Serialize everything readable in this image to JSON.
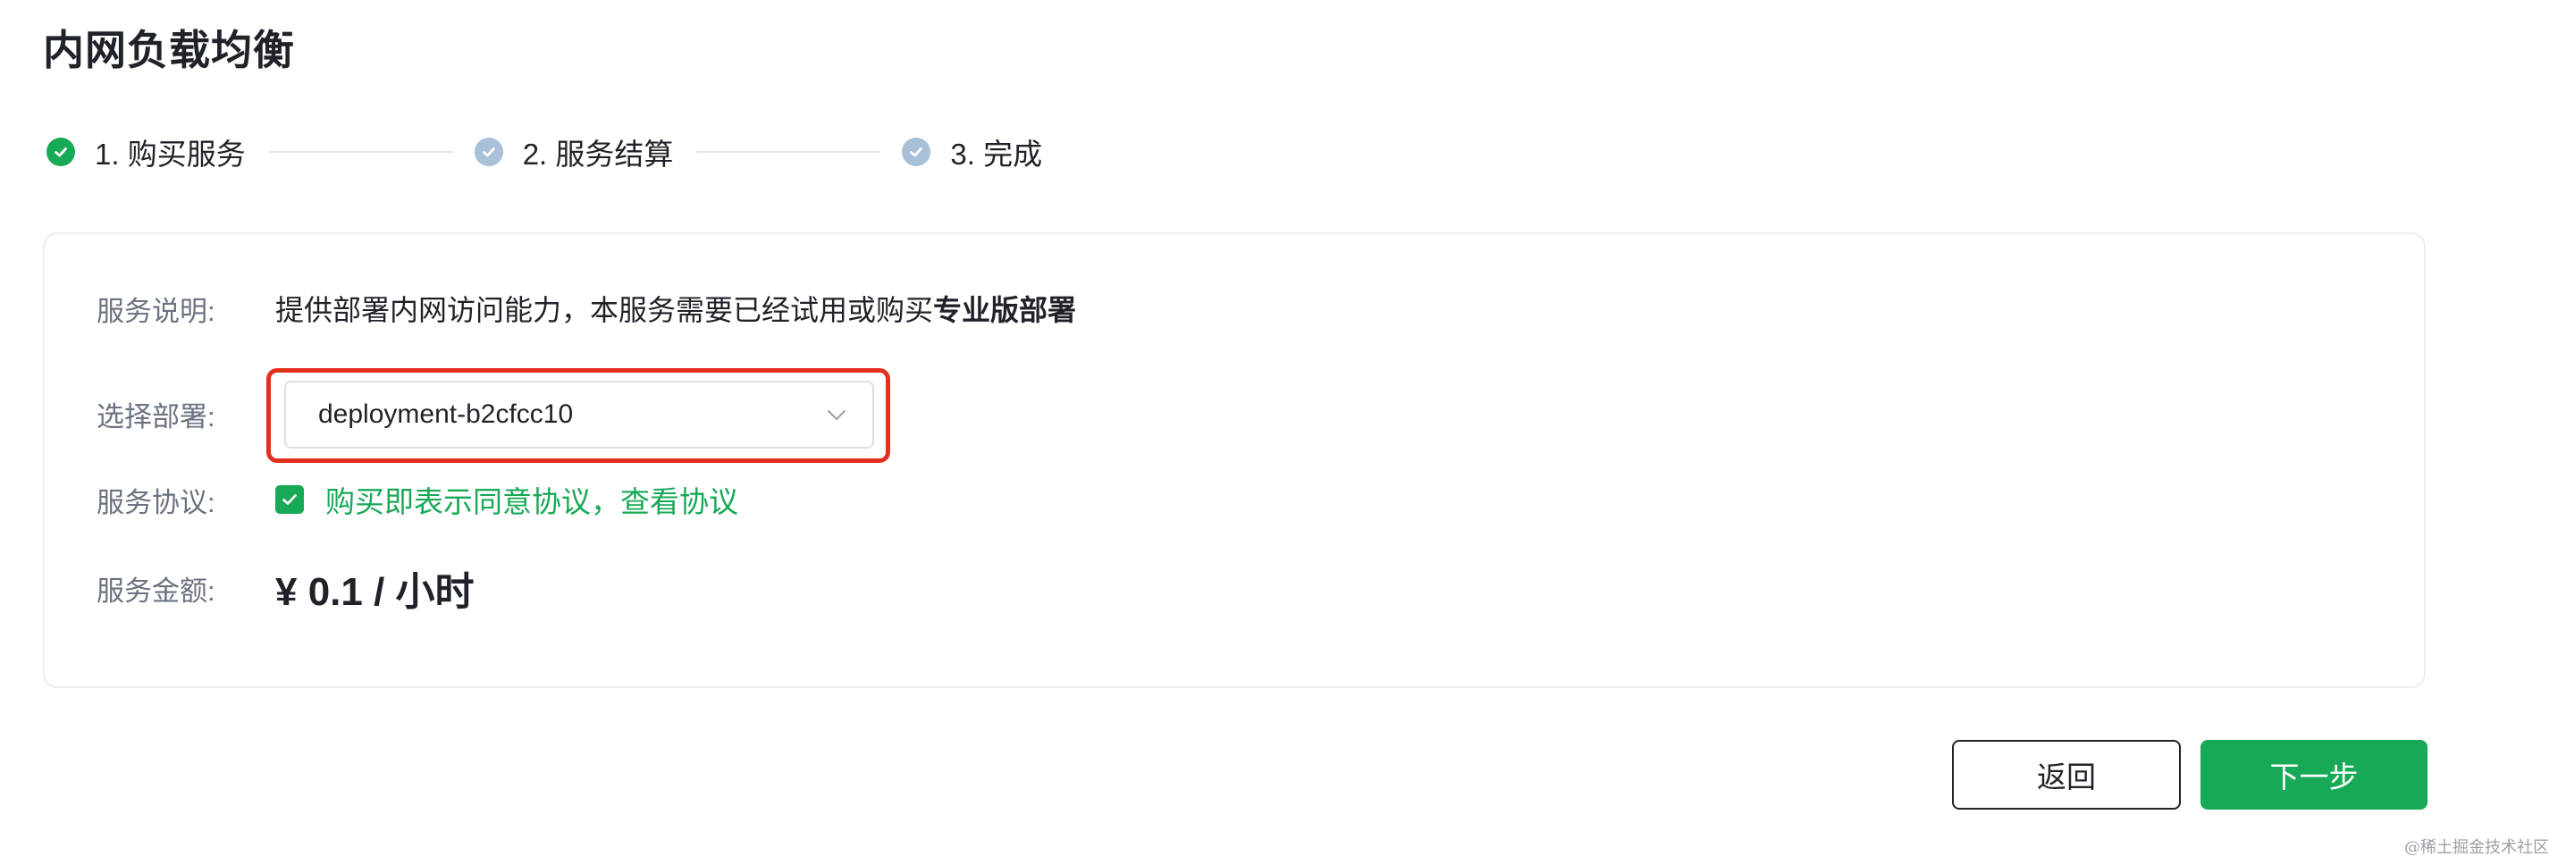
{
  "page": {
    "title": "内网负载均衡"
  },
  "steps": [
    {
      "label": "1. 购买服务",
      "status": "done"
    },
    {
      "label": "2. 服务结算",
      "status": "pending"
    },
    {
      "label": "3. 完成",
      "status": "pending"
    }
  ],
  "form": {
    "description_label": "服务说明:",
    "description_text": "提供部署内网访问能力，本服务需要已经试用或购买",
    "description_bold": "专业版部署",
    "deployment_label": "选择部署:",
    "deployment_value": "deployment-b2cfcc10",
    "agreement_label": "服务协议:",
    "agreement_text": "购买即表示同意协议，查看协议",
    "agreement_checked": true,
    "price_label": "服务金额:",
    "price_value": "¥ 0.1 / 小时"
  },
  "buttons": {
    "back_label": "返回",
    "next_label": "下一步"
  },
  "watermark": "@稀土掘金技术社区",
  "colors": {
    "primary": "#18a957",
    "pending_step": "#a8c0d8",
    "highlight": "#e2301f",
    "text": "#1f2329",
    "muted": "#6b7280"
  },
  "icons": {
    "step_done": "check-circle-icon",
    "step_pending": "check-circle-icon",
    "select_arrow": "chevron-down-icon",
    "checkbox": "checkmark-icon"
  }
}
